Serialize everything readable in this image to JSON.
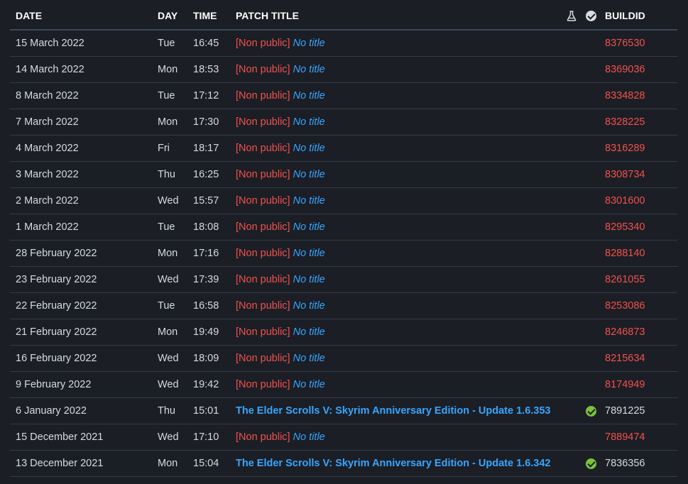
{
  "header": {
    "date": "DATE",
    "day": "DAY",
    "time": "TIME",
    "patch_title": "PATCH TITLE",
    "flask_icon": "flask-icon",
    "check_icon": "check-circle-icon",
    "buildid": "BUILDID"
  },
  "colors": {
    "background": "#1b1e25",
    "non_public": "#f2514c",
    "link": "#38a6ff",
    "check": "#7cc13a"
  },
  "rows": [
    {
      "date": "15 March 2022",
      "day": "Tue",
      "time": "16:45",
      "non_public": "[Non public]",
      "title": "No title",
      "build": "8376530",
      "verified": false
    },
    {
      "date": "14 March 2022",
      "day": "Mon",
      "time": "18:53",
      "non_public": "[Non public]",
      "title": "No title",
      "build": "8369036",
      "verified": false
    },
    {
      "date": "8 March 2022",
      "day": "Tue",
      "time": "17:12",
      "non_public": "[Non public]",
      "title": "No title",
      "build": "8334828",
      "verified": false
    },
    {
      "date": "7 March 2022",
      "day": "Mon",
      "time": "17:30",
      "non_public": "[Non public]",
      "title": "No title",
      "build": "8328225",
      "verified": false
    },
    {
      "date": "4 March 2022",
      "day": "Fri",
      "time": "18:17",
      "non_public": "[Non public]",
      "title": "No title",
      "build": "8316289",
      "verified": false
    },
    {
      "date": "3 March 2022",
      "day": "Thu",
      "time": "16:25",
      "non_public": "[Non public]",
      "title": "No title",
      "build": "8308734",
      "verified": false
    },
    {
      "date": "2 March 2022",
      "day": "Wed",
      "time": "15:57",
      "non_public": "[Non public]",
      "title": "No title",
      "build": "8301600",
      "verified": false
    },
    {
      "date": "1 March 2022",
      "day": "Tue",
      "time": "18:08",
      "non_public": "[Non public]",
      "title": "No title",
      "build": "8295340",
      "verified": false
    },
    {
      "date": "28 February 2022",
      "day": "Mon",
      "time": "17:16",
      "non_public": "[Non public]",
      "title": "No title",
      "build": "8288140",
      "verified": false
    },
    {
      "date": "23 February 2022",
      "day": "Wed",
      "time": "17:39",
      "non_public": "[Non public]",
      "title": "No title",
      "build": "8261055",
      "verified": false
    },
    {
      "date": "22 February 2022",
      "day": "Tue",
      "time": "16:58",
      "non_public": "[Non public]",
      "title": "No title",
      "build": "8253086",
      "verified": false
    },
    {
      "date": "21 February 2022",
      "day": "Mon",
      "time": "19:49",
      "non_public": "[Non public]",
      "title": "No title",
      "build": "8246873",
      "verified": false
    },
    {
      "date": "16 February 2022",
      "day": "Wed",
      "time": "18:09",
      "non_public": "[Non public]",
      "title": "No title",
      "build": "8215634",
      "verified": false
    },
    {
      "date": "9 February 2022",
      "day": "Wed",
      "time": "19:42",
      "non_public": "[Non public]",
      "title": "No title",
      "build": "8174949",
      "verified": false
    },
    {
      "date": "6 January 2022",
      "day": "Thu",
      "time": "15:01",
      "non_public": "",
      "title": "The Elder Scrolls V: Skyrim Anniversary Edition - Update 1.6.353",
      "build": "7891225",
      "verified": true
    },
    {
      "date": "15 December 2021",
      "day": "Wed",
      "time": "17:10",
      "non_public": "[Non public]",
      "title": "No title",
      "build": "7889474",
      "verified": false
    },
    {
      "date": "13 December 2021",
      "day": "Mon",
      "time": "15:04",
      "non_public": "",
      "title": "The Elder Scrolls V: Skyrim Anniversary Edition - Update 1.6.342",
      "build": "7836356",
      "verified": true
    }
  ]
}
